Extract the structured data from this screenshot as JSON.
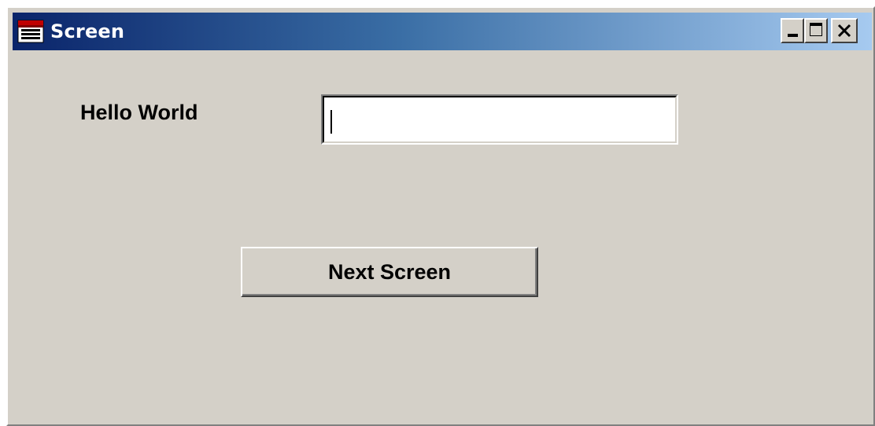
{
  "window": {
    "title": "Screen",
    "icon": "window-app-icon",
    "controls": {
      "minimize_icon": "minimize-icon",
      "maximize_icon": "maximize-icon",
      "close_icon": "close-icon"
    }
  },
  "form": {
    "label_text": "Hello World",
    "textbox_value": "",
    "textbox_placeholder": "",
    "next_button_label": "Next Screen"
  },
  "colors": {
    "titlebar_start": "#0a246a",
    "titlebar_end": "#a6caf0",
    "face": "#d4d0c8"
  }
}
